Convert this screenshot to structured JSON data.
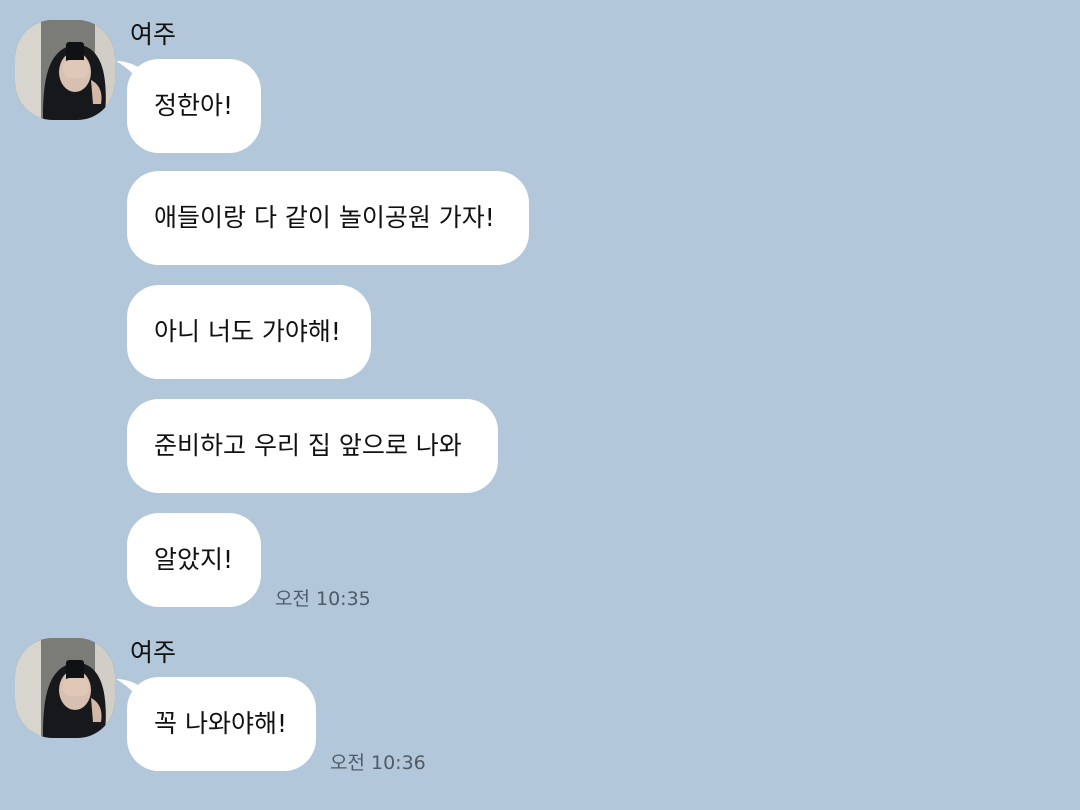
{
  "colors": {
    "chat_background": "#b2c7da",
    "bubble_background": "#ffffff",
    "text": "#111111",
    "timestamp": "#4f5b66"
  },
  "groups": [
    {
      "sender_name": "여주",
      "avatar_icon": "profile-photo",
      "messages": [
        "정한아!",
        "애들이랑 다 같이 놀이공원 가자!",
        "아니 너도 가야해!",
        "준비하고 우리 집 앞으로 나와",
        "알았지!"
      ],
      "time": "오전 10:35"
    },
    {
      "sender_name": "여주",
      "avatar_icon": "profile-photo",
      "messages": [
        "꼭 나와야해!"
      ],
      "time": "오전 10:36"
    }
  ]
}
